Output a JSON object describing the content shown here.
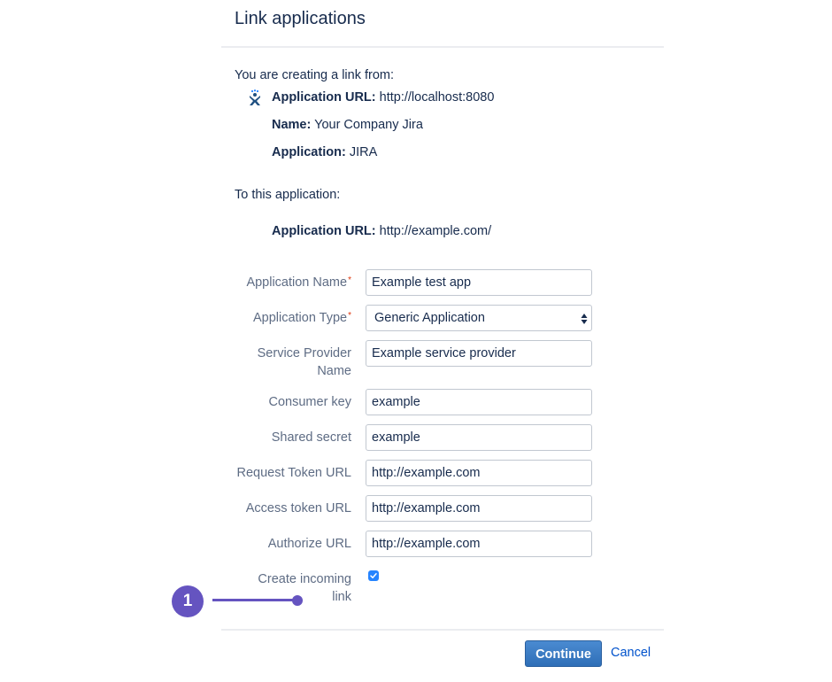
{
  "header": {
    "title": "Link applications"
  },
  "from": {
    "intro": "You are creating a link from:",
    "icon": "jira-logo-icon",
    "app_url_label": "Application URL:",
    "app_url_value": "http://localhost:8080",
    "name_label": "Name:",
    "name_value": "Your Company Jira",
    "application_label": "Application:",
    "application_value": "JIRA"
  },
  "to": {
    "intro": "To this application:",
    "app_url_label": "Application URL:",
    "app_url_value": "http://example.com/"
  },
  "form": {
    "required_marker": "*",
    "application_name": {
      "label": "Application Name",
      "value": "Example test app"
    },
    "application_type": {
      "label": "Application Type",
      "value": "Generic Application"
    },
    "service_provider_name": {
      "label_line1": "Service Provider",
      "label_line2": "Name",
      "value": "Example service provider"
    },
    "consumer_key": {
      "label": "Consumer key",
      "value": "example"
    },
    "shared_secret": {
      "label": "Shared secret",
      "value": "example"
    },
    "request_token_url": {
      "label": "Request Token URL",
      "value": "http://example.com"
    },
    "access_token_url": {
      "label": "Access token URL",
      "value": "http://example.com"
    },
    "authorize_url": {
      "label": "Authorize URL",
      "value": "http://example.com"
    },
    "create_incoming_link": {
      "label_line1": "Create incoming",
      "label_line2": "link",
      "checked": true
    }
  },
  "callout": {
    "number": "1",
    "color": "#6554c0"
  },
  "actions": {
    "continue_label": "Continue",
    "cancel_label": "Cancel"
  }
}
